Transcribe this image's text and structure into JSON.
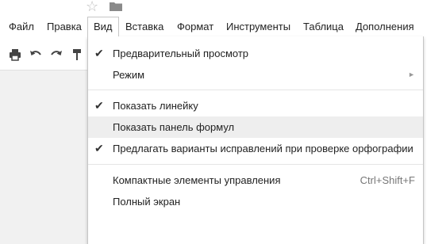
{
  "menubar": {
    "items": [
      {
        "label": "Файл"
      },
      {
        "label": "Правка"
      },
      {
        "label": "Вид"
      },
      {
        "label": "Вставка"
      },
      {
        "label": "Формат"
      },
      {
        "label": "Инструменты"
      },
      {
        "label": "Таблица"
      },
      {
        "label": "Дополнения"
      }
    ]
  },
  "top_icons": [
    "star-icon",
    "folder-icon"
  ],
  "toolbar": {
    "icons": [
      "print-icon",
      "undo-icon",
      "redo-icon",
      "paint-format-icon"
    ]
  },
  "view_menu": {
    "items": [
      {
        "label": "Предварительный просмотр",
        "checked": true
      },
      {
        "label": "Режим",
        "submenu": true
      },
      {
        "label": "Показать линейку",
        "checked": true
      },
      {
        "label": "Показать панель формул",
        "checked": false,
        "highlighted": true
      },
      {
        "label": "Предлагать варианты исправлений при проверке орфографии",
        "checked": true
      },
      {
        "label": "Компактные элементы управления",
        "shortcut": "Ctrl+Shift+F"
      },
      {
        "label": "Полный экран"
      }
    ],
    "check_glyph": "✔",
    "submenu_glyph": "►"
  },
  "colors": {
    "menu_border": "#c6c6c6",
    "highlight": "#eeeeee",
    "text": "#222222"
  }
}
